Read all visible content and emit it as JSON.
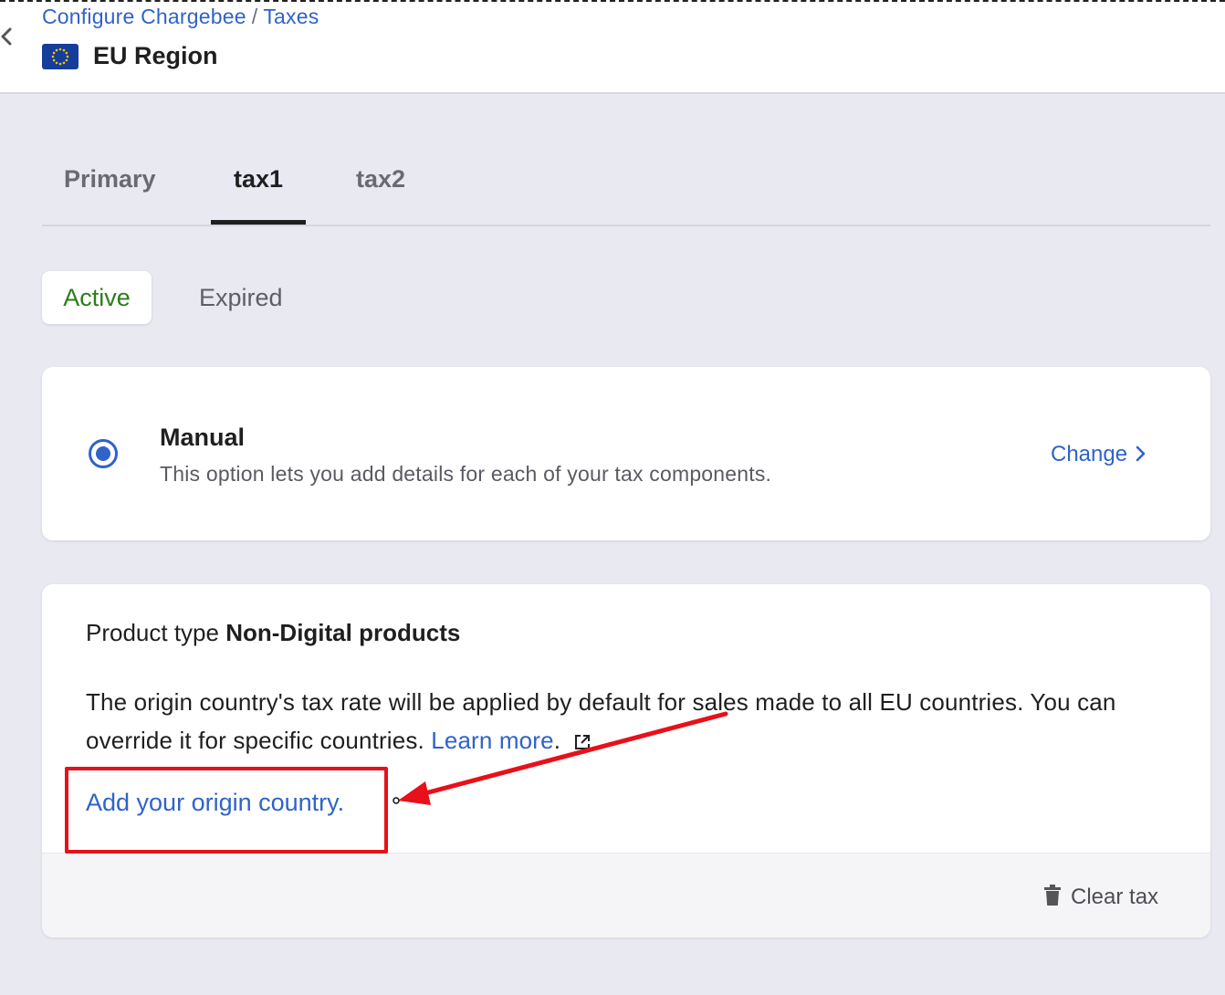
{
  "header": {
    "breadcrumb": [
      "Configure Chargebee",
      "Taxes"
    ],
    "breadcrumb_separator": "/",
    "title": "EU Region",
    "flag_icon": "eu-flag-icon",
    "back_icon": "chevron-left-icon"
  },
  "tabs": [
    {
      "label": "Primary",
      "active": false
    },
    {
      "label": "tax1",
      "active": true
    },
    {
      "label": "tax2",
      "active": false
    }
  ],
  "status_filters": [
    {
      "label": "Active",
      "selected": true
    },
    {
      "label": "Expired",
      "selected": false
    }
  ],
  "manual_card": {
    "title": "Manual",
    "description": "This option lets you add details for each of your tax components.",
    "change_label": "Change",
    "selected": true
  },
  "product_card": {
    "product_type_label": "Product type",
    "product_type_value": "Non-Digital products",
    "info_text": "The origin country's tax rate will be applied by default for sales made to all EU countries. You can override it for specific countries.",
    "learn_more_label": "Learn more",
    "add_origin_label": "Add your origin country.",
    "clear_tax_label": "Clear tax"
  },
  "annotation": {
    "highlight_color": "#e8101a"
  },
  "colors": {
    "link": "#2f63c9",
    "active_green": "#2e7d1e",
    "background": "#e9e9f2"
  }
}
